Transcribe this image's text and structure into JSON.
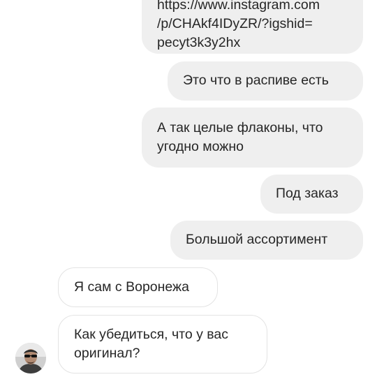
{
  "messages": [
    {
      "side": "outgoing",
      "text": "https://www.instagram.com\n/p/CHAkf4IDyZR/?igshid=\npecyt3k3y2hx"
    },
    {
      "side": "outgoing",
      "text": "Это что в распиве есть"
    },
    {
      "side": "outgoing",
      "text": "А так целые флаконы, что\nугодно можно"
    },
    {
      "side": "outgoing",
      "text": "Под заказ"
    },
    {
      "side": "outgoing",
      "text": "Большой ассортимент"
    },
    {
      "side": "incoming",
      "text": "Я сам с Воронежа"
    },
    {
      "side": "incoming",
      "text": "Как убедиться, что у вас\nоригинал?"
    }
  ],
  "colors": {
    "outgoing_bubble": "#efefef",
    "incoming_bubble_border": "#e3e3e3",
    "text": "#262626"
  },
  "avatar": {
    "icon": "user-avatar-sunglasses"
  }
}
